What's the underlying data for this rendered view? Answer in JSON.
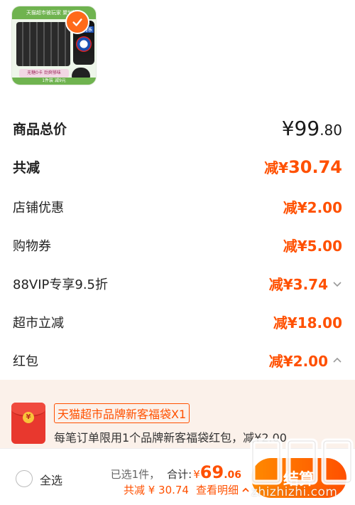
{
  "product": {
    "banner": "天猫超市被玩家 聚划算",
    "brand": "百事可乐",
    "promo": "无糖0卡 劲爽够味",
    "footer": "1件装 减9元"
  },
  "price_rows": [
    {
      "label": "商品总价",
      "currency": "¥",
      "int": "99",
      "dec": ".80"
    },
    {
      "label": "共减",
      "prefix": "减¥",
      "value": "30.74"
    },
    {
      "label": "店铺优惠",
      "value": "减¥2.00"
    },
    {
      "label": "购物券",
      "value": "减¥5.00"
    },
    {
      "label": "88VIP专享9.5折",
      "value": "减¥3.74"
    },
    {
      "label": "超市立减",
      "value": "减¥18.00"
    },
    {
      "label": "红包",
      "value": "减¥2.00"
    }
  ],
  "coupon": {
    "title": "天猫超市品牌新客福袋X1",
    "description": "每笔订单限用1个品牌新客福袋红包，减¥2.00",
    "seal": "¥"
  },
  "bottom_bar": {
    "select_all": "全选",
    "selected": "已选1件，",
    "total_label": "合计:",
    "currency": "¥",
    "pay_int": "69",
    "pay_dec": ".06",
    "discount": "共减 ¥ 30.74",
    "view_detail": "查看明细",
    "checkout": "结算"
  },
  "watermark": "zhizhizhi.com",
  "colors": {
    "accent": "#ff5000",
    "panel": "#fbf1ea"
  }
}
